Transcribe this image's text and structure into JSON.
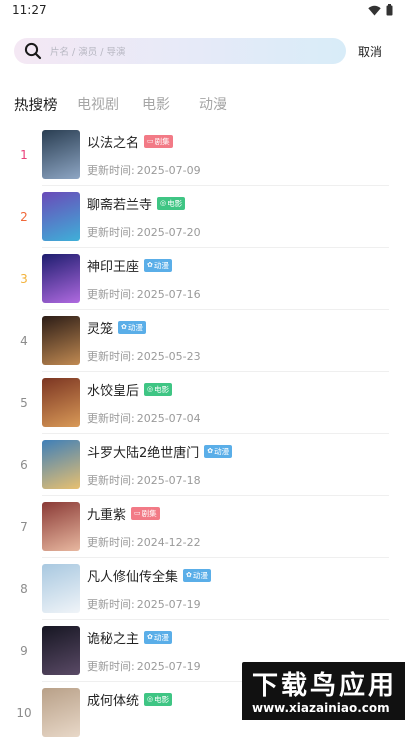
{
  "status_bar": {
    "time": "11:27"
  },
  "search": {
    "placeholder": "片名 / 演员 / 导演",
    "cancel_label": "取消"
  },
  "tabs": [
    {
      "label": "热搜榜",
      "active": true
    },
    {
      "label": "电视剧",
      "active": false
    },
    {
      "label": "电影",
      "active": false
    },
    {
      "label": "动漫",
      "active": false
    }
  ],
  "update_prefix": "更新时间:",
  "badge_styles": {
    "剧集": {
      "color": "#f27a86",
      "glyph": "▭"
    },
    "电影": {
      "color": "#3fc584",
      "glyph": "◎"
    },
    "动漫": {
      "color": "#5aaee8",
      "glyph": "✿"
    }
  },
  "rank_colors": {
    "1": "#ea3f7a",
    "2": "#f0693a",
    "3": "#f3b23a",
    "default": "#8c8c8c"
  },
  "items": [
    {
      "rank": "1",
      "title": "以法之名",
      "badge": "剧集",
      "update_date": "2025-07-09",
      "poster_colors": [
        "#2a3e52",
        "#8ea6c4"
      ]
    },
    {
      "rank": "2",
      "title": "聊斋若兰寺",
      "badge": "电影",
      "update_date": "2025-07-20",
      "poster_colors": [
        "#6a4ab8",
        "#3fb0d8"
      ]
    },
    {
      "rank": "3",
      "title": "神印王座",
      "badge": "动漫",
      "update_date": "2025-07-16",
      "poster_colors": [
        "#1d1d6e",
        "#b06ae0"
      ]
    },
    {
      "rank": "4",
      "title": "灵笼",
      "badge": "动漫",
      "update_date": "2025-05-23",
      "poster_colors": [
        "#2b1c16",
        "#c18a52"
      ]
    },
    {
      "rank": "5",
      "title": "水饺皇后",
      "badge": "电影",
      "update_date": "2025-07-04",
      "poster_colors": [
        "#7b3522",
        "#d99a58"
      ]
    },
    {
      "rank": "6",
      "title": "斗罗大陆2绝世唐门",
      "badge": "动漫",
      "update_date": "2025-07-18",
      "poster_colors": [
        "#3f7fb8",
        "#e8c070"
      ]
    },
    {
      "rank": "7",
      "title": "九重紫",
      "badge": "剧集",
      "update_date": "2024-12-22",
      "poster_colors": [
        "#8a3a36",
        "#e8b8a0"
      ]
    },
    {
      "rank": "8",
      "title": "凡人修仙传全集",
      "badge": "动漫",
      "update_date": "2025-07-19",
      "poster_colors": [
        "#a8c8e0",
        "#f0f4f8"
      ]
    },
    {
      "rank": "9",
      "title": "诡秘之主",
      "badge": "动漫",
      "update_date": "2025-07-19",
      "poster_colors": [
        "#161622",
        "#5a4a66"
      ]
    },
    {
      "rank": "10",
      "title": "成何体统",
      "badge": "电影",
      "update_date": "",
      "poster_colors": [
        "#b8a088",
        "#e8d8c8"
      ]
    }
  ],
  "watermark": {
    "main": "下载鸟应用",
    "url": "www.xiazainiao.com"
  }
}
